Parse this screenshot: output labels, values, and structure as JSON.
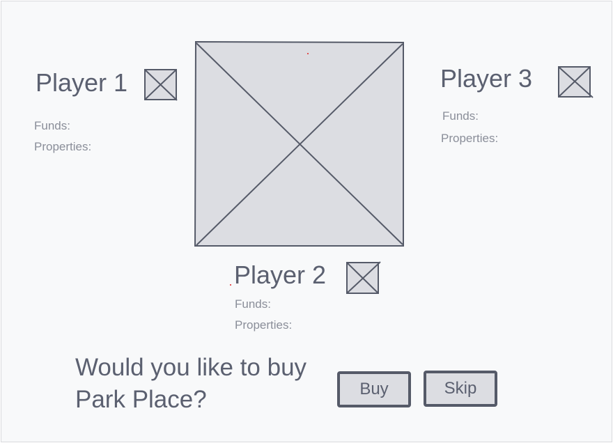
{
  "players": [
    {
      "name": "Player 1",
      "funds_label": "Funds:",
      "properties_label": "Properties:",
      "avatar_icon": "image-placeholder-icon"
    },
    {
      "name": "Player 2",
      "funds_label": "Funds:",
      "properties_label": "Properties:",
      "avatar_icon": "image-placeholder-icon"
    },
    {
      "name": "Player 3",
      "funds_label": "Funds:",
      "properties_label": "Properties:",
      "avatar_icon": "image-placeholder-icon"
    }
  ],
  "board": {
    "icon": "image-placeholder-icon"
  },
  "prompt": {
    "line1": "Would you like to buy",
    "line2": "Park Place?"
  },
  "actions": {
    "buy_label": "Buy",
    "skip_label": "Skip"
  },
  "colors": {
    "placeholder_fill": "#dcdde2",
    "placeholder_stroke": "#555a68",
    "text": "#5b6070",
    "muted_text": "#8a8e99",
    "background": "#f8f9fa"
  }
}
